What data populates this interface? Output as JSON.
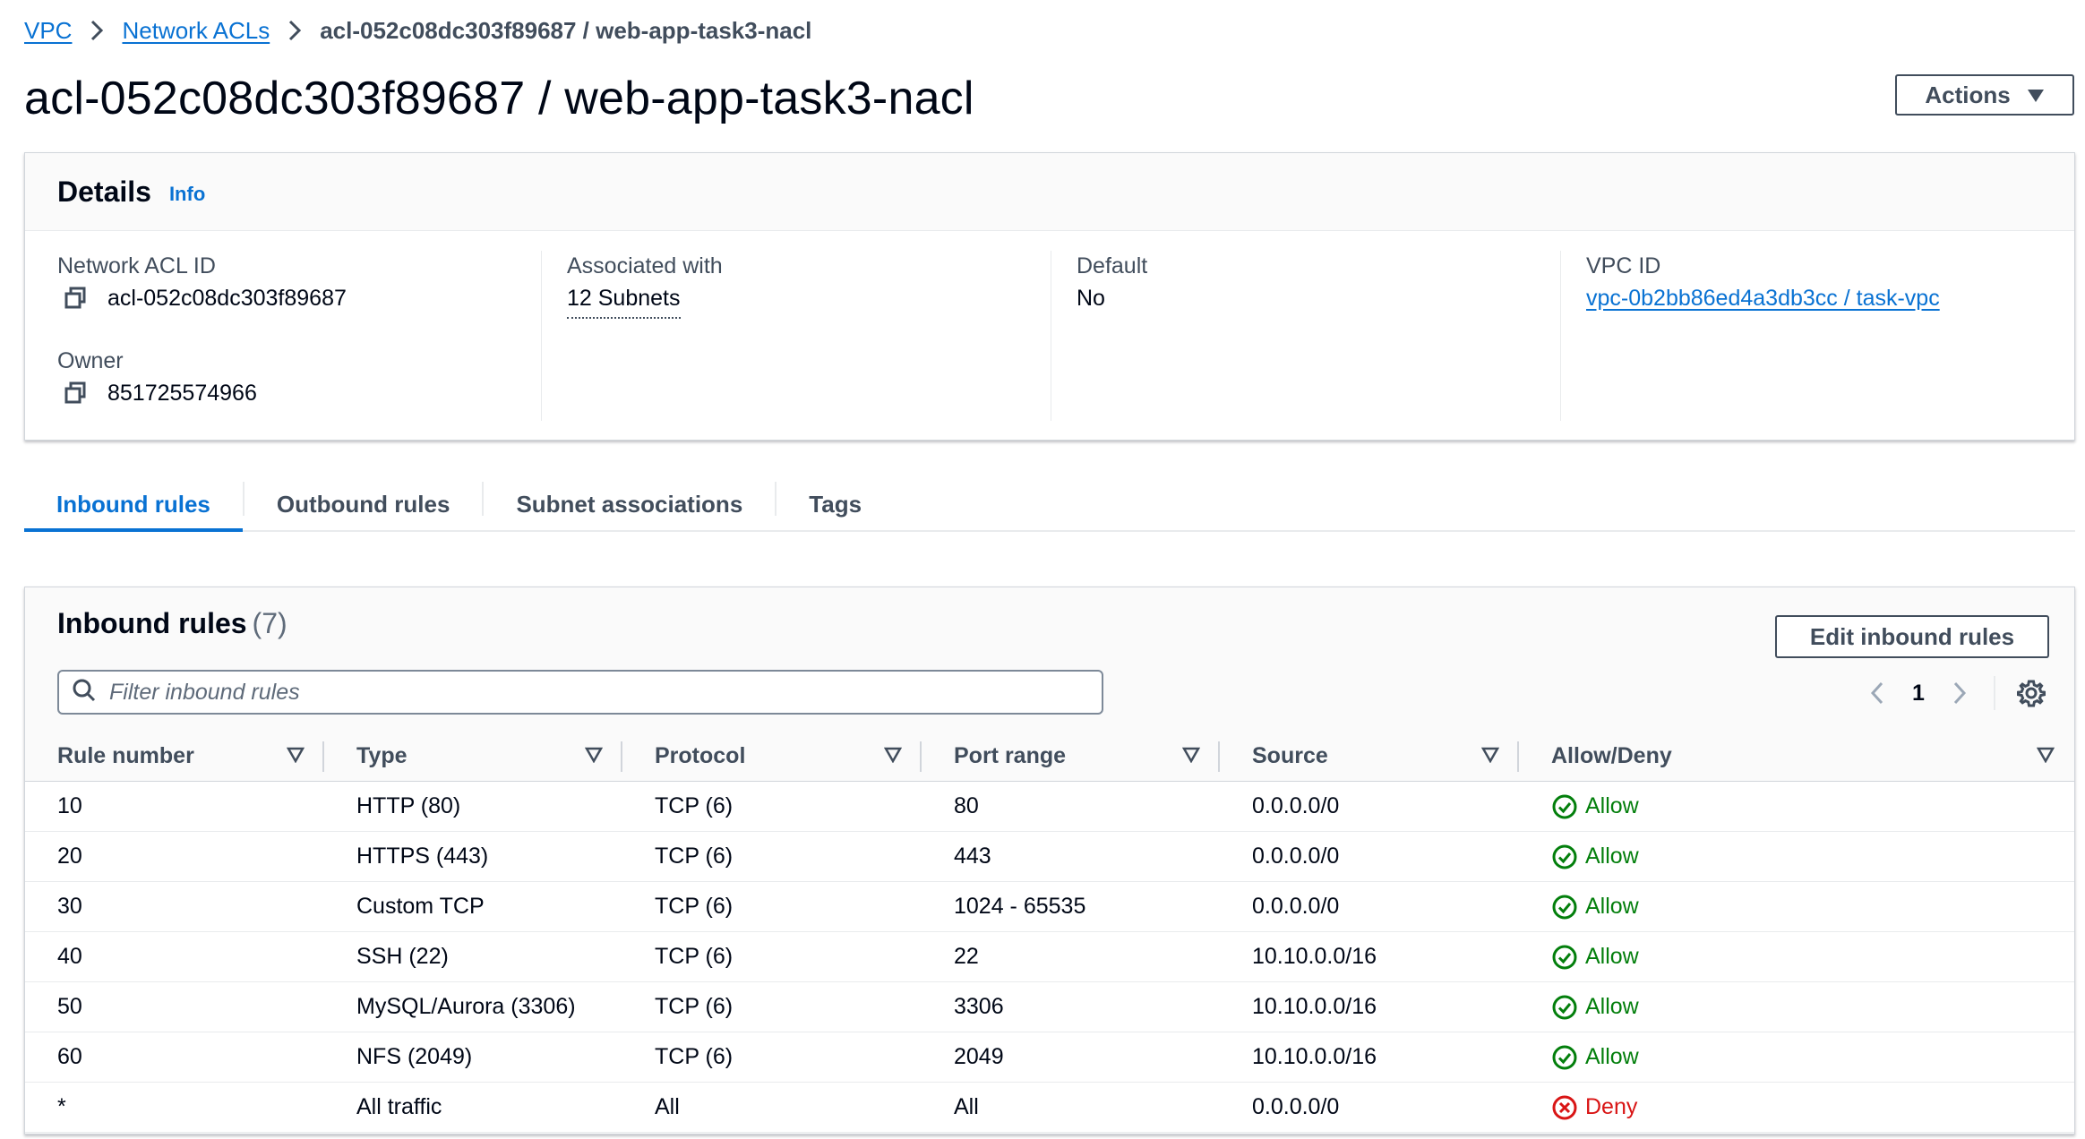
{
  "breadcrumb": {
    "items": [
      "VPC",
      "Network ACLs"
    ],
    "current": "acl-052c08dc303f89687 / web-app-task3-nacl"
  },
  "page": {
    "title": "acl-052c08dc303f89687 / web-app-task3-nacl",
    "actions_label": "Actions"
  },
  "details": {
    "heading": "Details",
    "info_label": "Info",
    "network_acl_id_label": "Network ACL ID",
    "network_acl_id": "acl-052c08dc303f89687",
    "owner_label": "Owner",
    "owner": "851725574966",
    "associated_label": "Associated with",
    "associated_value": "12 Subnets",
    "default_label": "Default",
    "default_value": "No",
    "vpc_id_label": "VPC ID",
    "vpc_id_value": "vpc-0b2bb86ed4a3db3cc / task-vpc"
  },
  "tabs": [
    "Inbound rules",
    "Outbound rules",
    "Subnet associations",
    "Tags"
  ],
  "inbound": {
    "title": "Inbound rules",
    "count": "(7)",
    "edit_label": "Edit inbound rules",
    "filter_placeholder": "Filter inbound rules",
    "page": "1",
    "columns": [
      "Rule number",
      "Type",
      "Protocol",
      "Port range",
      "Source",
      "Allow/Deny"
    ],
    "rows": [
      {
        "rule": "10",
        "type": "HTTP (80)",
        "protocol": "TCP (6)",
        "port": "80",
        "source": "0.0.0.0/0",
        "action": "Allow"
      },
      {
        "rule": "20",
        "type": "HTTPS (443)",
        "protocol": "TCP (6)",
        "port": "443",
        "source": "0.0.0.0/0",
        "action": "Allow"
      },
      {
        "rule": "30",
        "type": "Custom TCP",
        "protocol": "TCP (6)",
        "port": "1024 - 65535",
        "source": "0.0.0.0/0",
        "action": "Allow"
      },
      {
        "rule": "40",
        "type": "SSH (22)",
        "protocol": "TCP (6)",
        "port": "22",
        "source": "10.10.0.0/16",
        "action": "Allow"
      },
      {
        "rule": "50",
        "type": "MySQL/Aurora (3306)",
        "protocol": "TCP (6)",
        "port": "3306",
        "source": "10.10.0.0/16",
        "action": "Allow"
      },
      {
        "rule": "60",
        "type": "NFS (2049)",
        "protocol": "TCP (6)",
        "port": "2049",
        "source": "10.10.0.0/16",
        "action": "Allow"
      },
      {
        "rule": "*",
        "type": "All traffic",
        "protocol": "All",
        "port": "All",
        "source": "0.0.0.0/0",
        "action": "Deny"
      }
    ]
  },
  "icons": {
    "copy": "copy-icon",
    "search": "search-icon",
    "settings": "gear-icon",
    "allow": "check-circle-icon",
    "deny": "x-circle-icon"
  },
  "colors": {
    "link": "#0972d3",
    "allow": "#037f0c",
    "deny": "#d91515",
    "text": "#000716"
  }
}
